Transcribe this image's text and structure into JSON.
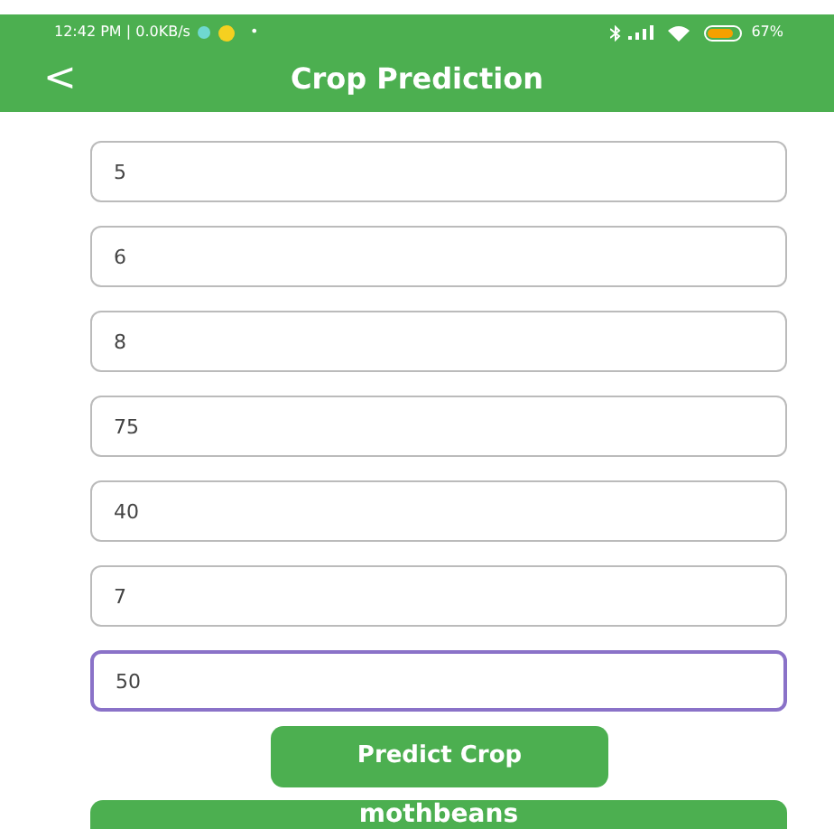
{
  "status_bar": {
    "time": "12:42 PM | 0.0KB/s",
    "dot": "•",
    "battery": "67%"
  },
  "app_bar": {
    "back": "<",
    "title": "Crop Prediction"
  },
  "fields": [
    {
      "value": "5",
      "focused": false
    },
    {
      "value": "6",
      "focused": false
    },
    {
      "value": "8",
      "focused": false
    },
    {
      "value": "75",
      "focused": false
    },
    {
      "value": "40",
      "focused": false
    },
    {
      "value": "7",
      "focused": false
    },
    {
      "value": "50",
      "focused": true
    }
  ],
  "button": "Predict Crop",
  "result": "mothbeans"
}
